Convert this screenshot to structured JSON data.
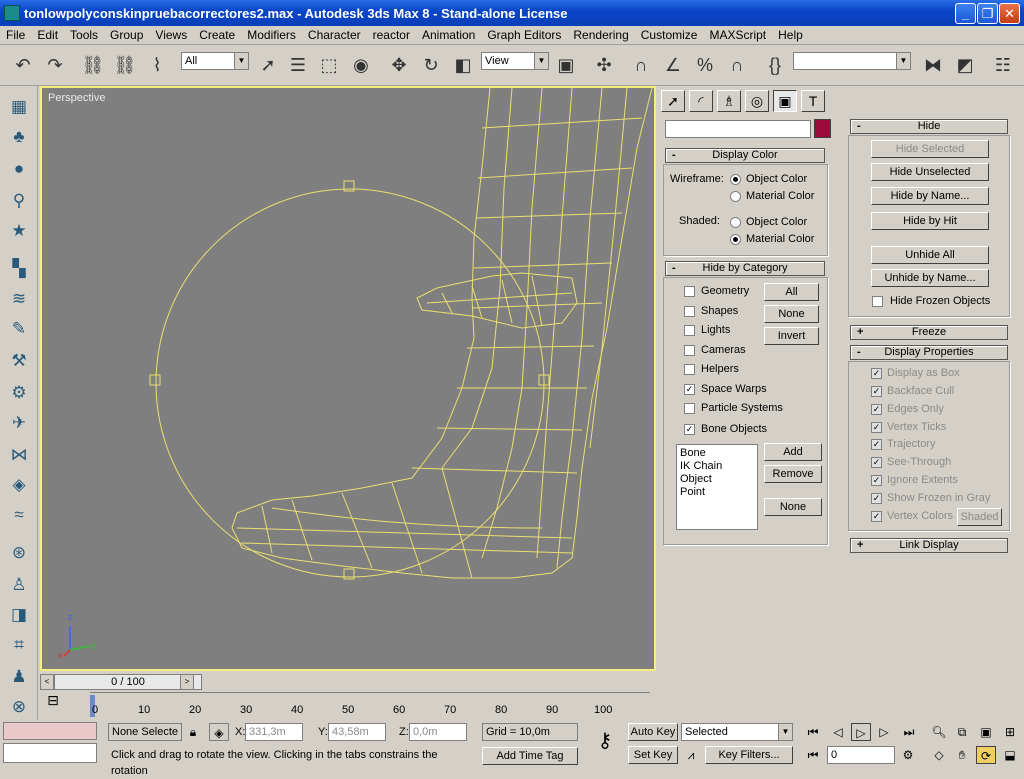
{
  "window": {
    "title": "tonlowpolyconskinpruebacorrectores2.max - Autodesk 3ds Max 8  - Stand-alone License",
    "min": "_",
    "max": "❐",
    "close": "✕"
  },
  "menu": [
    "File",
    "Edit",
    "Tools",
    "Group",
    "Views",
    "Create",
    "Modifiers",
    "Character",
    "reactor",
    "Animation",
    "Graph Editors",
    "Rendering",
    "Customize",
    "MAXScript",
    "Help"
  ],
  "toolbar": {
    "selection_filter": "All",
    "ref_coord": "View",
    "named_sel": "",
    "icons": [
      "undo-icon",
      "redo-icon",
      "link-icon",
      "unlink-icon",
      "bind-space-warp-icon",
      "select-icon",
      "select-by-name-icon",
      "rect-region-icon",
      "window-crossing-icon",
      "move-icon",
      "rotate-icon",
      "scale-icon",
      "pivot-icon",
      "manipulate-icon",
      "snap-3-icon",
      "angle-snap-icon",
      "percent-snap-icon",
      "spinner-snap-icon",
      "edit-named-sel-icon",
      "mirror-icon",
      "align-icon",
      "layer-icon"
    ]
  },
  "viewport": {
    "label": "Perspective",
    "axis": {
      "x": "x",
      "y": "y",
      "z": "z"
    },
    "wire_color": "#e8e070"
  },
  "time_slider": {
    "label": "0 / 100",
    "prev": "<",
    "next": ">"
  },
  "trackbar": {
    "ticks": [
      "0",
      "10",
      "20",
      "30",
      "40",
      "50",
      "60",
      "70",
      "80",
      "90",
      "100"
    ]
  },
  "command_panel": {
    "tabs": [
      "create-tab",
      "modify-tab",
      "hierarchy-tab",
      "motion-tab",
      "display-tab",
      "utilities-tab"
    ],
    "object_name": "",
    "object_color": "#9a0a3a",
    "display_color": {
      "header": "Display Color",
      "wireframe_label": "Wireframe:",
      "shaded_label": "Shaded:",
      "object_color": "Object Color",
      "material_color": "Material Color"
    },
    "hide_by_category": {
      "header": "Hide by Category",
      "items": [
        {
          "label": "Geometry",
          "checked": false
        },
        {
          "label": "Shapes",
          "checked": false
        },
        {
          "label": "Lights",
          "checked": false
        },
        {
          "label": "Cameras",
          "checked": false
        },
        {
          "label": "Helpers",
          "checked": false
        },
        {
          "label": "Space Warps",
          "checked": true
        },
        {
          "label": "Particle Systems",
          "checked": false
        },
        {
          "label": "Bone Objects",
          "checked": true
        }
      ],
      "btn_all": "All",
      "btn_none": "None",
      "btn_invert": "Invert",
      "list": [
        "Bone",
        "IK Chain Object",
        "Point"
      ],
      "btn_add": "Add",
      "btn_remove": "Remove",
      "btn_list_none": "None"
    },
    "hide": {
      "header": "Hide",
      "hide_selected": "Hide Selected",
      "hide_unselected": "Hide Unselected",
      "hide_by_name": "Hide by Name...",
      "hide_by_hit": "Hide by Hit",
      "unhide_all": "Unhide All",
      "unhide_by_name": "Unhide by Name...",
      "hide_frozen": "Hide Frozen Objects"
    },
    "freeze": {
      "header": "Freeze"
    },
    "display_properties": {
      "header": "Display Properties",
      "items": [
        "Display as Box",
        "Backface Cull",
        "Edges Only",
        "Vertex Ticks",
        "Trajectory",
        "See-Through",
        "Ignore Extents",
        "Show Frozen in Gray",
        "Vertex Colors"
      ],
      "shaded_btn": "Shaded"
    },
    "link_display": {
      "header": "Link Display"
    },
    "plus": "+",
    "minus": "-"
  },
  "status": {
    "selection": "None Selecte",
    "x_label": "X:",
    "x_value": "331,3m",
    "y_label": "Y:",
    "y_value": "43,58m",
    "z_label": "Z:",
    "z_value": "0,0m",
    "grid": "Grid = 10,0m",
    "prompt": "Click and drag to rotate the view.  Clicking in the tabs constrains the rotation",
    "add_time_tag": "Add Time Tag",
    "auto_key": "Auto Key",
    "set_key": "Set Key",
    "key_mode": "Selected",
    "key_filters": "Key Filters...",
    "frame": "0"
  }
}
